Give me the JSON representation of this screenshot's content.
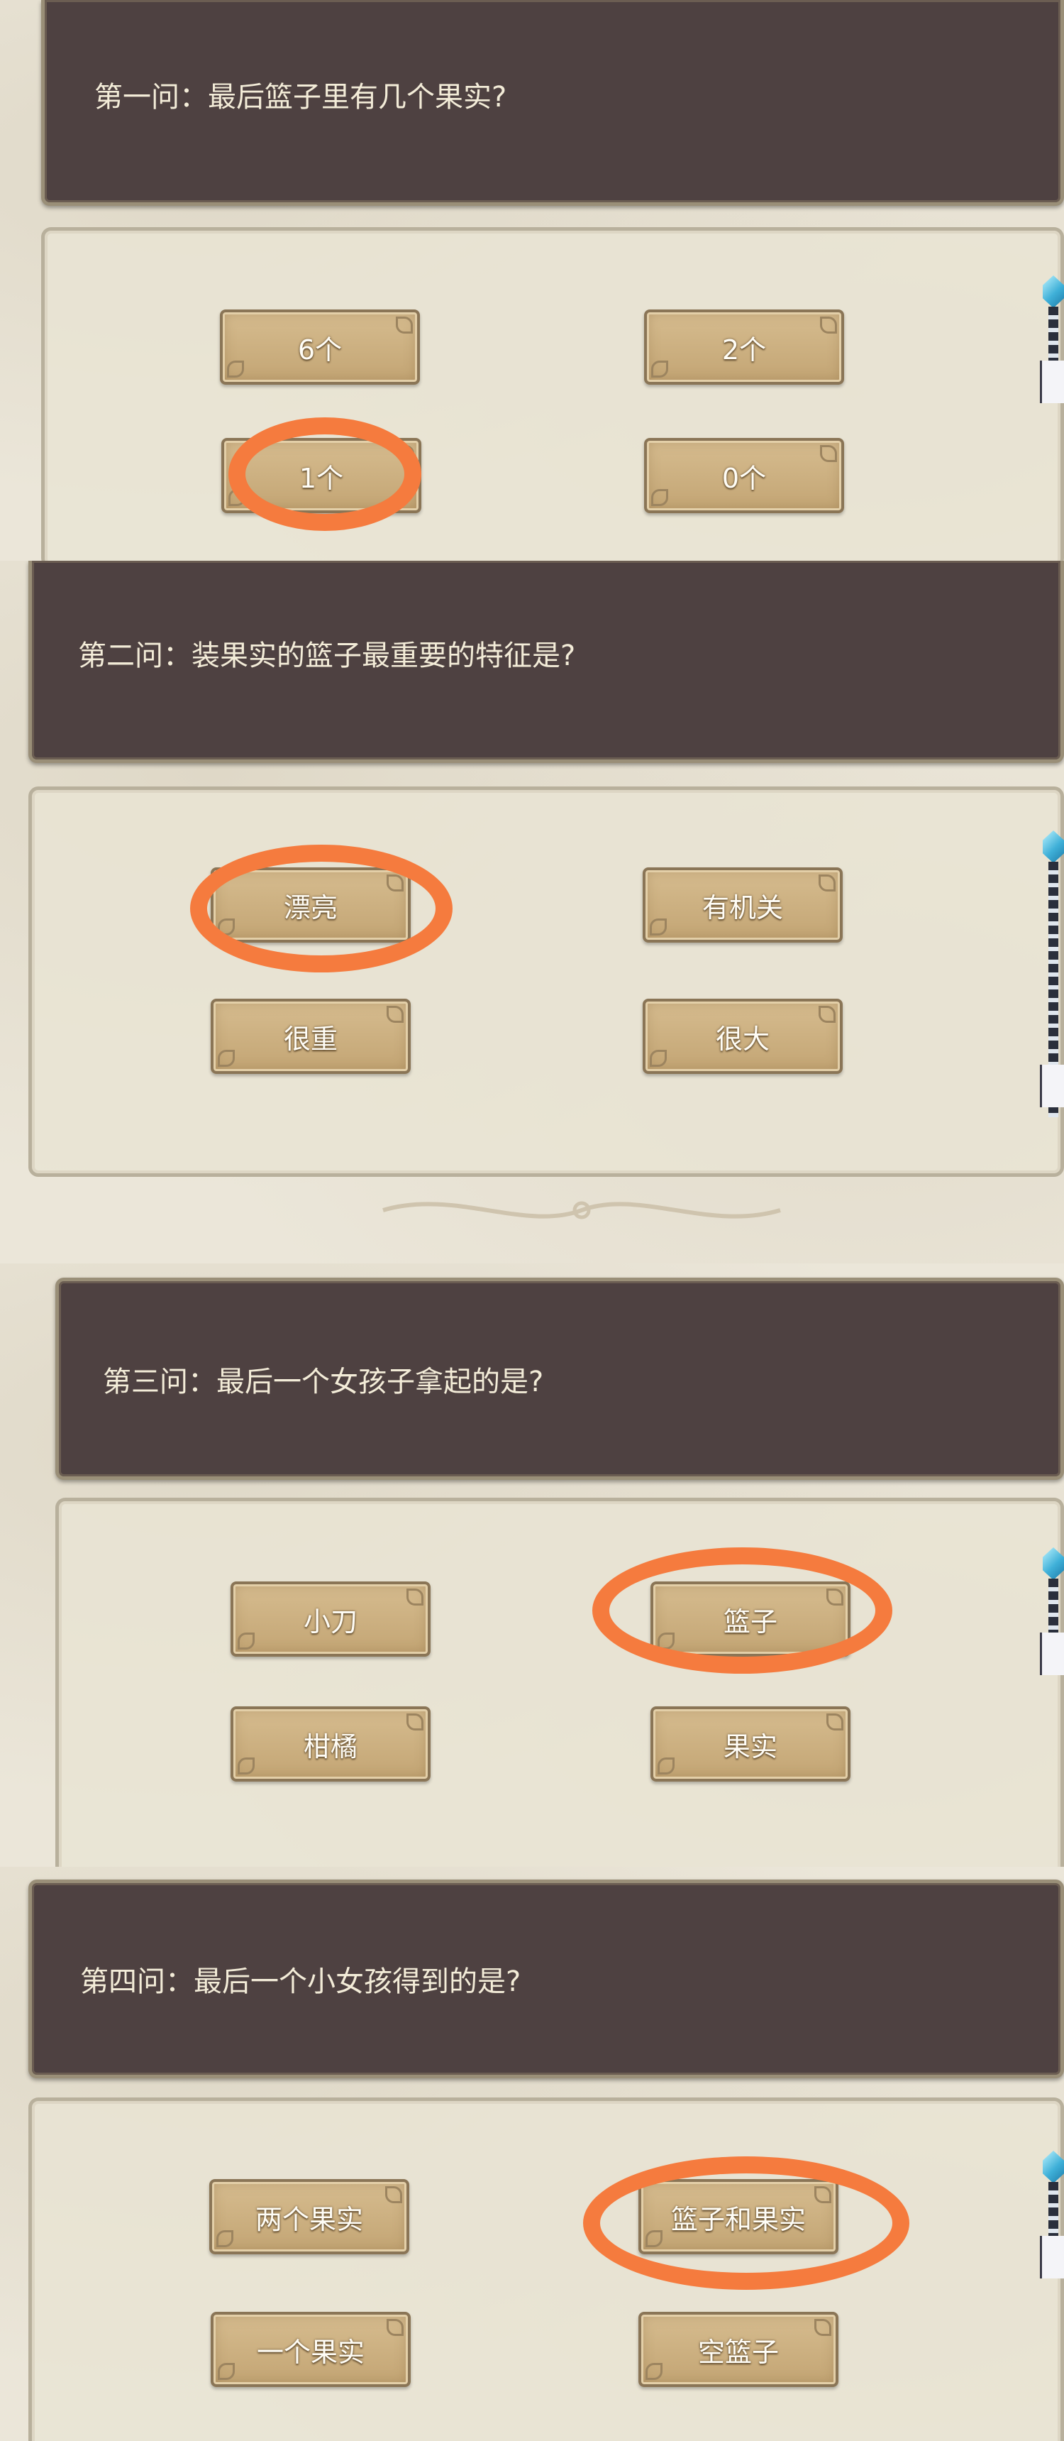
{
  "questions": [
    {
      "title": "第一问：最后篮子里有几个果实?",
      "options": [
        "6个",
        "2个",
        "1个",
        "0个"
      ],
      "circled": "1个"
    },
    {
      "title": "第二问：装果实的篮子最重要的特征是?",
      "options": [
        "漂亮",
        "有机关",
        "很重",
        "很大"
      ],
      "circled": "漂亮"
    },
    {
      "title": "第三问：最后一个女孩子拿起的是?",
      "options": [
        "小刀",
        "篮子",
        "柑橘",
        "果实"
      ],
      "circled": "篮子"
    },
    {
      "title": "第四问：最后一个小女孩得到的是?",
      "options": [
        "两个果实",
        "篮子和果实",
        "一个果实",
        "空篮子"
      ],
      "circled": "篮子和果实"
    }
  ],
  "colors": {
    "question_bg": "#4e4141",
    "option_bg": "#c9ad7e",
    "highlight": "#f57b3e",
    "paper": "#ebe6d9"
  },
  "icons": [
    "staff-gem-icon"
  ]
}
